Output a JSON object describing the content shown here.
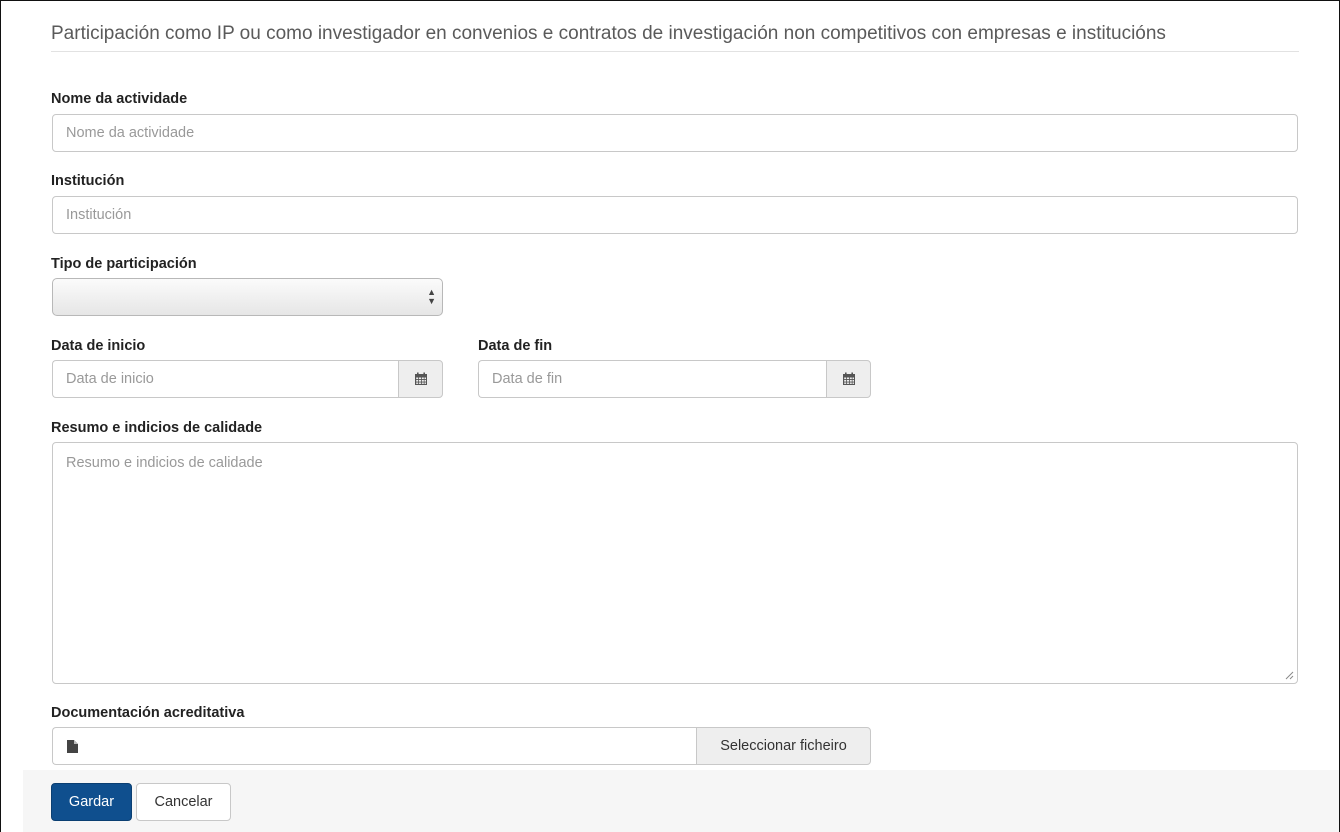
{
  "form": {
    "legend": "Participación como IP ou como investigador en convenios e contratos de investigación non competitivos con empresas e institucións",
    "fields": {
      "activity_name": {
        "label": "Nome da actividade",
        "placeholder": "Nome da actividade"
      },
      "institution": {
        "label": "Institución",
        "placeholder": "Institución"
      },
      "participation_type": {
        "label": "Tipo de participación",
        "value": ""
      },
      "start_date": {
        "label": "Data de inicio",
        "placeholder": "Data de inicio",
        "icon": "calendar-icon"
      },
      "end_date": {
        "label": "Data de fin",
        "placeholder": "Data de fin",
        "icon": "calendar-icon"
      },
      "summary": {
        "label": "Resumo e indicios de calidade",
        "placeholder": "Resumo e indicios de calidade"
      },
      "documentation": {
        "label": "Documentación acreditativa",
        "browse_label": "Seleccionar ficheiro",
        "icon": "file-icon"
      }
    },
    "buttons": {
      "save": "Gardar",
      "cancel": "Cancelar"
    },
    "colors": {
      "primary_button": "#0f4f8e"
    }
  }
}
